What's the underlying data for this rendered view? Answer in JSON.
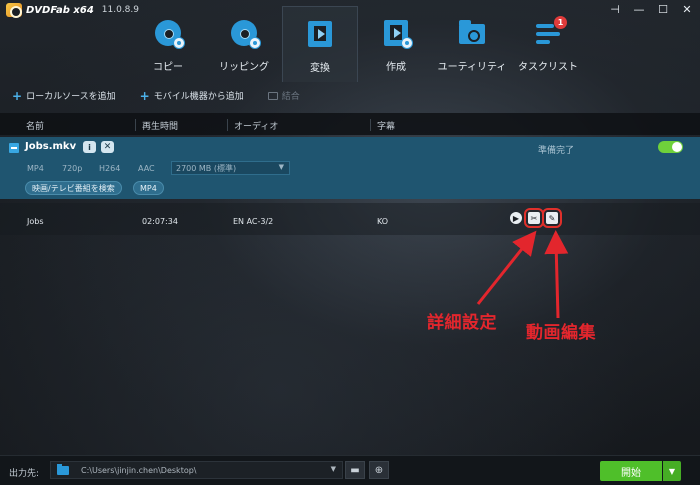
{
  "app": {
    "logo": "DVDFab x64",
    "version": "11.0.8.9"
  },
  "window_controls": {
    "pin": "⊣",
    "minimize": "—",
    "maximize": "☐",
    "close": "✕"
  },
  "nav": [
    {
      "label": "コピー",
      "icon": "copy-disc-icon"
    },
    {
      "label": "リッピング",
      "icon": "ripper-disc-icon"
    },
    {
      "label": "変換",
      "icon": "converter-film-icon",
      "active": true
    },
    {
      "label": "作成",
      "icon": "creator-film-icon"
    },
    {
      "label": "ユーティリティ",
      "icon": "utilities-folder-icon"
    },
    {
      "label": "タスクリスト",
      "icon": "task-list-icon",
      "badge": "1"
    }
  ],
  "toolbar": {
    "add_local": "ローカルソースを追加",
    "add_mobile": "モバイル機器から追加",
    "merge": "結合"
  },
  "columns": {
    "name": "名前",
    "duration": "再生時間",
    "audio": "オーディオ",
    "subtitle": "字幕"
  },
  "file": {
    "name": "Jobs.mkv",
    "info_glyph": "i",
    "close_glyph": "✕",
    "status": "準備完了",
    "specs": {
      "container": "MP4",
      "resolution": "720p",
      "codec": "H264",
      "audio": "AAC"
    },
    "size_option": "2700 MB (標準)",
    "search_button": "映画/テレビ番組を検索",
    "format_button": "MP4"
  },
  "track": {
    "name": "Jobs",
    "duration": "02:07:34",
    "audio": "EN AC-3/2",
    "subtitle": "KO"
  },
  "annotations": {
    "advanced": "詳細設定",
    "video_edit": "動画編集"
  },
  "colors": {
    "accent": "#2a98d8",
    "start": "#4fbf2a",
    "annotation": "#e3262d",
    "file_row": "#1f5570"
  },
  "bottom": {
    "output_label": "出力先:",
    "output_path": "C:\\Users\\jinjin.chen\\Desktop\\",
    "start_button": "開始"
  }
}
